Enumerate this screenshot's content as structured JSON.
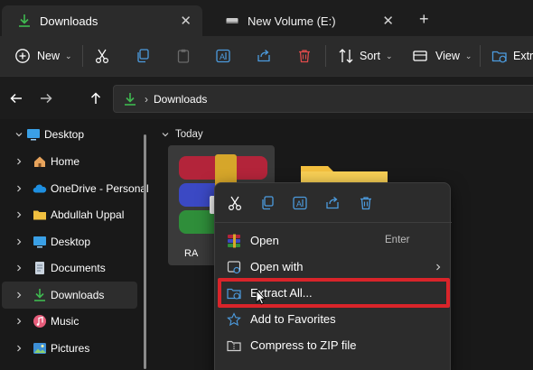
{
  "tabs": [
    {
      "label": "Downloads",
      "icon": "download-icon",
      "active": true
    },
    {
      "label": "New Volume (E:)",
      "icon": "drive-icon",
      "active": false
    }
  ],
  "new_tab_label": "+",
  "toolbar": {
    "new_label": "New",
    "sort_label": "Sort",
    "view_label": "View",
    "extract_label": "Extra"
  },
  "address": {
    "separator": "›",
    "path": "Downloads"
  },
  "sidebar": {
    "items": [
      {
        "label": "Desktop",
        "icon": "desktop-icon",
        "expanded": true
      },
      {
        "label": "Home",
        "icon": "home-icon"
      },
      {
        "label": "OneDrive - Personal",
        "icon": "cloud-icon"
      },
      {
        "label": "Abdullah Uppal",
        "icon": "folder-icon"
      },
      {
        "label": "Desktop",
        "icon": "desktop-icon"
      },
      {
        "label": "Documents",
        "icon": "documents-icon"
      },
      {
        "label": "Downloads",
        "icon": "download-icon",
        "selected": true
      },
      {
        "label": "Music",
        "icon": "music-icon"
      },
      {
        "label": "Pictures",
        "icon": "pictures-icon"
      }
    ]
  },
  "content": {
    "group_label": "Today",
    "file_label": "RA"
  },
  "context_menu": {
    "items": [
      {
        "label": "Open",
        "shortcut": "Enter",
        "icon": "winrar-icon"
      },
      {
        "label": "Open with",
        "icon": "open-with-icon",
        "submenu": true
      },
      {
        "label": "Extract All...",
        "icon": "extract-icon",
        "highlighted": true
      },
      {
        "label": "Add to Favorites",
        "icon": "star-icon"
      },
      {
        "label": "Compress to ZIP file",
        "icon": "zip-icon"
      }
    ]
  },
  "colors": {
    "accent_green": "#3fb950",
    "highlight_red": "#d9242a",
    "background": "#191919",
    "toolbar": "#2b2b2b"
  }
}
